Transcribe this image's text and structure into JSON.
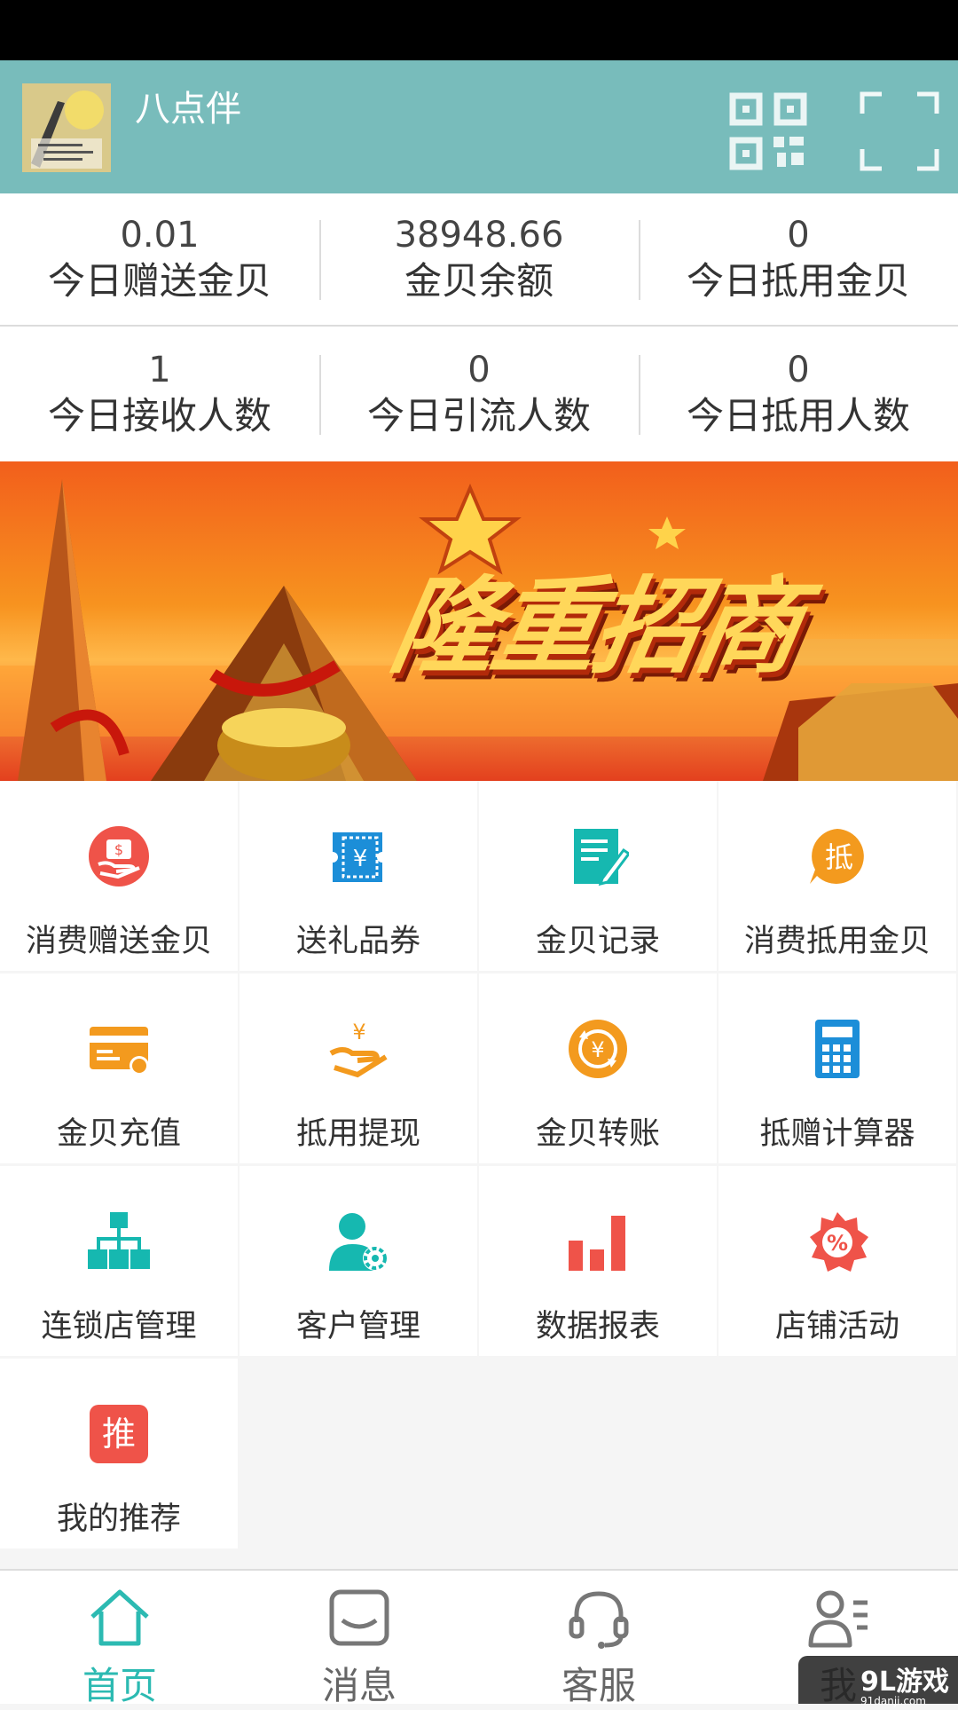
{
  "header": {
    "app_name": "八点伴",
    "qr_icon": "qr-code-icon",
    "scan_icon": "scan-icon"
  },
  "stats": {
    "row1": [
      {
        "value": "0.01",
        "label": "今日赠送金贝"
      },
      {
        "value": "38948.66",
        "label": "金贝余额"
      },
      {
        "value": "0",
        "label": "今日抵用金贝"
      }
    ],
    "row2": [
      {
        "value": "1",
        "label": "今日接收人数"
      },
      {
        "value": "0",
        "label": "今日引流人数"
      },
      {
        "value": "0",
        "label": "今日抵用人数"
      }
    ]
  },
  "banner": {
    "text": "隆重招商",
    "slide_count": 3,
    "active_slide": 3
  },
  "menu": [
    {
      "label": "消费赠送金贝",
      "icon": "hand-coin-icon",
      "color": "#ef5349"
    },
    {
      "label": "送礼品券",
      "icon": "gift-ticket-icon",
      "color": "#1c8ed8"
    },
    {
      "label": "金贝记录",
      "icon": "record-edit-icon",
      "color": "#16b8b0"
    },
    {
      "label": "消费抵用金贝",
      "icon": "deduct-badge-icon",
      "color": "#f39a1e"
    },
    {
      "label": "金贝充值",
      "icon": "card-recharge-icon",
      "color": "#f39a1e"
    },
    {
      "label": "抵用提现",
      "icon": "withdraw-hand-icon",
      "color": "#f39a1e"
    },
    {
      "label": "金贝转账",
      "icon": "transfer-coin-icon",
      "color": "#f39a1e"
    },
    {
      "label": "抵赠计算器",
      "icon": "calculator-icon",
      "color": "#1c8ed8"
    },
    {
      "label": "连锁店管理",
      "icon": "org-chart-icon",
      "color": "#16b8b0"
    },
    {
      "label": "客户管理",
      "icon": "user-settings-icon",
      "color": "#16b8b0"
    },
    {
      "label": "数据报表",
      "icon": "bar-chart-icon",
      "color": "#ef5349"
    },
    {
      "label": "店铺活动",
      "icon": "discount-badge-icon",
      "color": "#ef5349"
    },
    {
      "label": "我的推荐",
      "icon": "recommend-badge-icon",
      "color": "#ef5349"
    }
  ],
  "tabbar": {
    "tabs": [
      {
        "label": "首页",
        "icon": "home-icon"
      },
      {
        "label": "消息",
        "icon": "message-icon"
      },
      {
        "label": "客服",
        "icon": "headset-icon"
      },
      {
        "label": "我",
        "icon": "profile-icon"
      }
    ],
    "active": "首页",
    "active_color": "#2cbab2"
  },
  "watermark": {
    "brand": "9L游戏",
    "url": "91danji.com"
  }
}
